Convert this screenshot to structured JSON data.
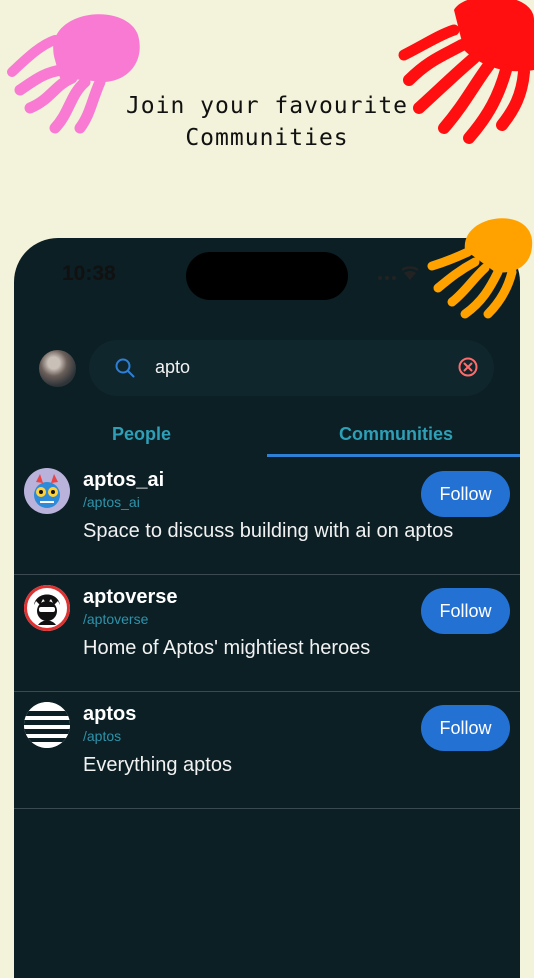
{
  "headline": {
    "line1": "Join your favourite",
    "line2": "Communities"
  },
  "status_bar": {
    "time": "10:38"
  },
  "search": {
    "value": "apto"
  },
  "tabs": [
    {
      "label": "People",
      "active": false
    },
    {
      "label": "Communities",
      "active": true
    }
  ],
  "communities": [
    {
      "name": "aptos_ai",
      "handle": "/aptos_ai",
      "description": "Space to discuss building with ai on aptos",
      "follow_label": "Follow"
    },
    {
      "name": "aptoverse",
      "handle": "/aptoverse",
      "description": "Home of Aptos' mightiest heroes",
      "follow_label": "Follow"
    },
    {
      "name": "aptos",
      "handle": "/aptos",
      "description": "Everything aptos",
      "follow_label": "Follow"
    }
  ],
  "colors": {
    "background": "#f3f2da",
    "phone_bg": "#0b1f24",
    "accent_tab": "#2e9fb6",
    "follow_button": "#2471d4",
    "jelly_pink": "#f87ad2",
    "jelly_red": "#ff0f0f",
    "jelly_orange": "#ffa200"
  }
}
